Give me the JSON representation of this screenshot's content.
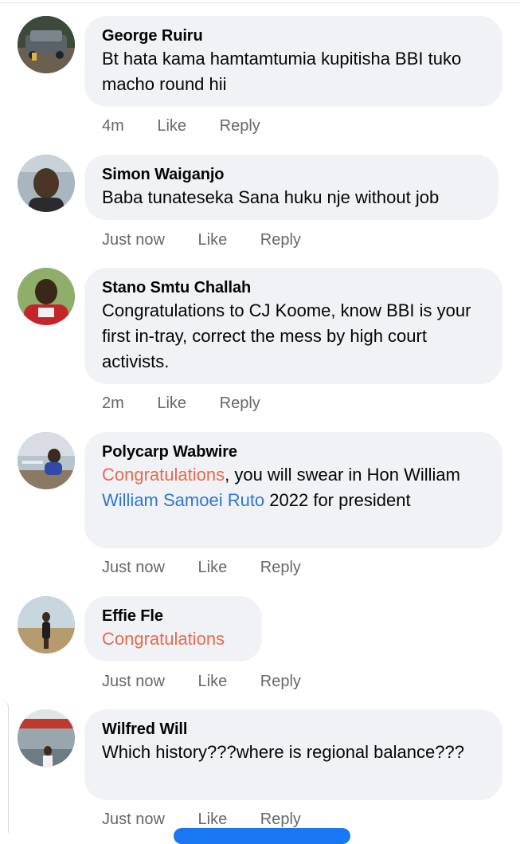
{
  "comments": [
    {
      "author": "George Ruiru",
      "text": "Bt hata kama hamtamtumia kupitisha BBI tuko macho round hii",
      "time": "4m",
      "like": "Like",
      "reply": "Reply"
    },
    {
      "author": "Simon Waiganjo",
      "text": "Baba tunateseka Sana huku nje without job",
      "time": "Just now",
      "like": "Like",
      "reply": "Reply"
    },
    {
      "author": "Stano Smtu Challah",
      "text": "Congratulations to CJ Koome, know BBI is your first in-tray, correct the mess by high court activists.",
      "time": "2m",
      "like": "Like",
      "reply": "Reply"
    },
    {
      "author": "Polycarp Wabwire",
      "text_tag": "Congratulations",
      "text_mid": ", you will swear in Hon William ",
      "text_link": "William Samoei Ruto",
      "text_end": " 2022 for president",
      "time": "Just now",
      "like": "Like",
      "reply": "Reply"
    },
    {
      "author": "Effie Fle",
      "text_tag": "Congratulations",
      "time": "Just now",
      "like": "Like",
      "reply": "Reply"
    },
    {
      "author": "Wilfred Will",
      "text": "Which history???where is regional balance???",
      "time": "Just now",
      "like": "Like",
      "reply": "Reply"
    }
  ],
  "icons": [
    "avatar-photo"
  ],
  "colors": {
    "bubble": "#f0f2f5",
    "meta": "#65676b",
    "tag": "#e8694f",
    "link": "#2f76d2",
    "accent": "#1877f2"
  }
}
